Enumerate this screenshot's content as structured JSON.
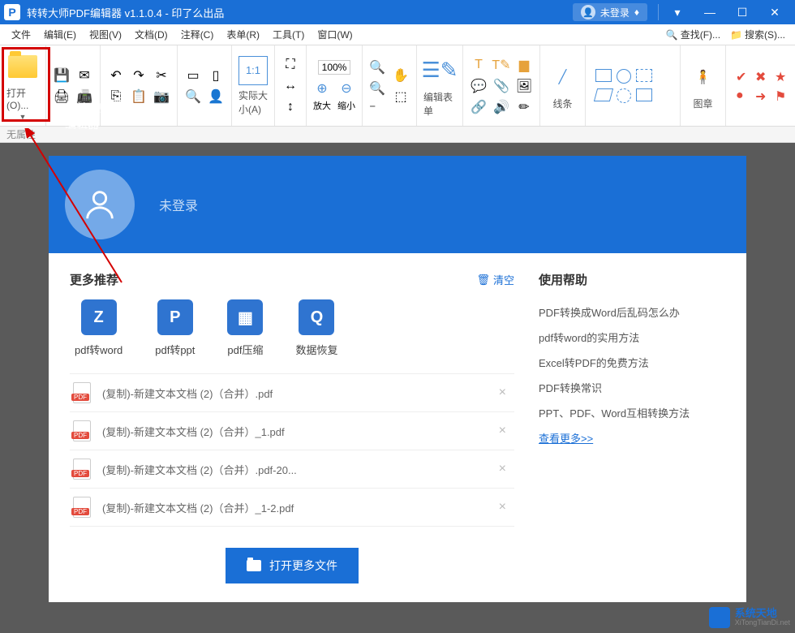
{
  "titlebar": {
    "title": "转转大师PDF编辑器 v1.1.0.4 - 印了么出品",
    "user_status": "未登录"
  },
  "menubar": {
    "items": [
      "文件",
      "编辑(E)",
      "视图(V)",
      "文档(D)",
      "注释(C)",
      "表单(R)",
      "工具(T)",
      "窗口(W)"
    ],
    "find": "查找(F)...",
    "search": "搜索(S)..."
  },
  "toolbar": {
    "open": "打开(O)...",
    "actual_size": "实际大小(A)",
    "zoom_value": "100%",
    "zoom_in": "放大",
    "zoom_out": "缩小",
    "edit_form": "编辑表单",
    "lines": "线条",
    "stamp": "图章"
  },
  "status_strip": "无属性",
  "header": {
    "product": "转转大师PDF编辑器",
    "login": "未登录"
  },
  "recommend": {
    "title": "更多推荐",
    "clear": "清空",
    "apps": [
      {
        "label": "pdf转word",
        "icon": "Z"
      },
      {
        "label": "pdf转ppt",
        "icon": "P"
      },
      {
        "label": "pdf压缩",
        "icon": "▦"
      },
      {
        "label": "数据恢复",
        "icon": "Q"
      }
    ]
  },
  "files": [
    "(复制)-新建文本文档 (2)（合并）.pdf",
    "(复制)-新建文本文档 (2)（合并）_1.pdf",
    "(复制)-新建文本文档 (2)（合并）.pdf-20...",
    "(复制)-新建文本文档 (2)（合并）_1-2.pdf"
  ],
  "help": {
    "title": "使用帮助",
    "items": [
      "PDF转换成Word后乱码怎么办",
      "pdf转word的实用方法",
      "Excel转PDF的免费方法",
      "PDF转换常识",
      "PPT、PDF、Word互相转换方法"
    ],
    "more": "查看更多>>"
  },
  "open_more": "打开更多文件",
  "watermark": {
    "main": "系统天地",
    "sub": "XiTongTianDi.net"
  }
}
